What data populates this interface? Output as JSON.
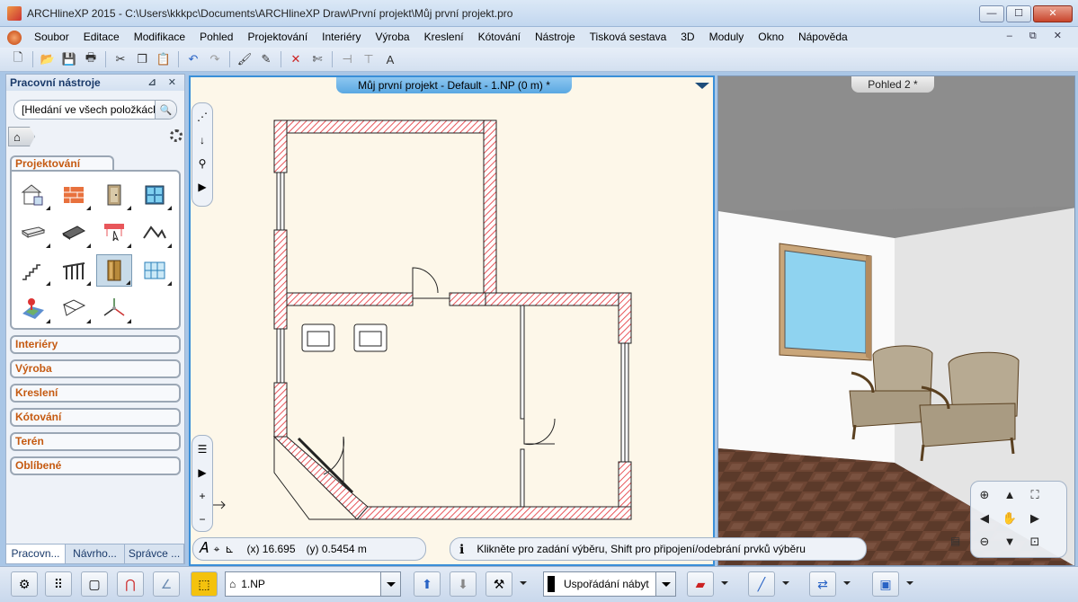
{
  "window": {
    "title": "ARCHlineXP 2015 - C:\\Users\\kkkpc\\Documents\\ARCHlineXP Draw\\První projekt\\Můj první projekt.pro",
    "controls": {
      "minimize": "—",
      "maximize": "☐",
      "close": "✕"
    }
  },
  "menu": {
    "items": [
      "Soubor",
      "Editace",
      "Modifikace",
      "Pohled",
      "Projektování",
      "Interiéry",
      "Výroba",
      "Kreslení",
      "Kótování",
      "Nástroje",
      "Tisková sestava",
      "3D",
      "Moduly",
      "Okno",
      "Nápověda"
    ],
    "mdi_controls": "– ⧉ ✕"
  },
  "left_panel": {
    "title": "Pracovní nástroje",
    "pin_close": "⊿ ✕",
    "search": {
      "value": "[Hledání ve všech položkách"
    },
    "active_group": "Projektování",
    "groups": [
      "Interiéry",
      "Výroba",
      "Kreslení",
      "Kótování",
      "Terén",
      "Oblíbené"
    ],
    "tabs": [
      "Pracovn...",
      "Návrho...",
      "Správce ..."
    ]
  },
  "view2d": {
    "title": "Můj první projekt - Default - 1.NP (0 m) *",
    "coords": {
      "x": "(x) 16.695",
      "y": "(y) 0.5454 m"
    }
  },
  "view3d": {
    "title": "Pohled 2 *"
  },
  "status": {
    "message": "Klikněte pro zadání výběru, Shift pro připojení/odebrání prvků výběru"
  },
  "bottom": {
    "floor": "1.NP",
    "arrangement": "Uspořádání nábyt"
  },
  "colors": {
    "wall_hatch": "#e8565a",
    "accent_orange": "#c55a11",
    "active_view_border": "#3a8fd8"
  }
}
